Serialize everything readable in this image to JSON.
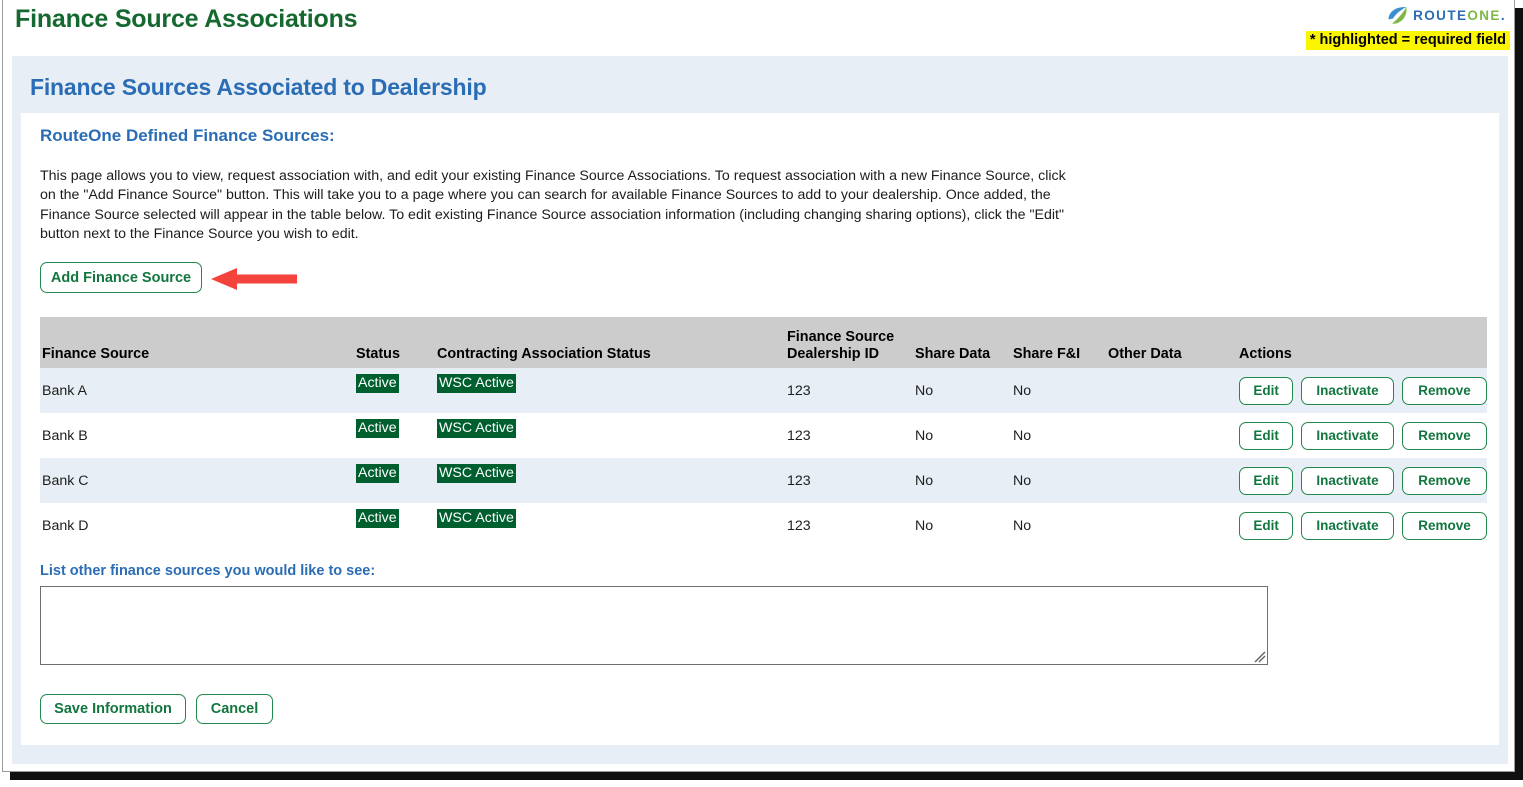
{
  "window": {
    "title": "Finance Source Associations"
  },
  "brand": {
    "logo_icon": "routeone-leaf-icon",
    "name_part1": "ROUTE",
    "name_part2": "ONE",
    "name_suffix": ".",
    "color_blue": "#2a6db5",
    "color_green": "#7cb843"
  },
  "required_note": {
    "text": "* highlighted = required field",
    "background": "#fcf500"
  },
  "panel": {
    "heading": "Finance Sources Associated to Dealership"
  },
  "card": {
    "heading": "RouteOne Defined Finance Sources:",
    "description": "This page allows you to view, request association with, and edit your existing Finance Source Associations. To request association with a new Finance Source, click on the \"Add Finance Source\" button. This will take you to a page where you can search for available Finance Sources to add to your dealership. Once added, the Finance Source selected will appear in the table below. To edit existing Finance Source association information (including changing sharing options), click the \"Edit\" button next to the Finance Source you wish to edit.",
    "add_button_label": "Add Finance Source"
  },
  "annotation": {
    "arrow_icon": "left-arrow-annotation-icon",
    "arrow_color": "#f4433c",
    "points_to": "Add Finance Source"
  },
  "table": {
    "columns": [
      "Finance Source",
      "Status",
      "Contracting Association Status",
      "Finance Source\nDealership ID",
      "Share Data",
      "Share F&I",
      "Other Data",
      "Actions"
    ],
    "column_header_finance_source_dealership_id_line1": "Finance Source",
    "column_header_finance_source_dealership_id_line2": "Dealership ID",
    "header_background": "#cccccc",
    "badge_color": "#005f2e",
    "rows": [
      {
        "finance_source": "Bank A",
        "status": "Active",
        "contracting_association_status": "WSC Active",
        "dealership_id": "123",
        "share_data": "No",
        "share_fi": "No",
        "other_data": "",
        "actions": [
          "Edit",
          "Inactivate",
          "Remove"
        ]
      },
      {
        "finance_source": "Bank B",
        "status": "Active",
        "contracting_association_status": "WSC Active",
        "dealership_id": "123",
        "share_data": "No",
        "share_fi": "No",
        "other_data": "",
        "actions": [
          "Edit",
          "Inactivate",
          "Remove"
        ]
      },
      {
        "finance_source": "Bank C",
        "status": "Active",
        "contracting_association_status": "WSC Active",
        "dealership_id": "123",
        "share_data": "No",
        "share_fi": "No",
        "other_data": "",
        "actions": [
          "Edit",
          "Inactivate",
          "Remove"
        ]
      },
      {
        "finance_source": "Bank D",
        "status": "Active",
        "contracting_association_status": "WSC Active",
        "dealership_id": "123",
        "share_data": "No",
        "share_fi": "No",
        "other_data": "",
        "actions": [
          "Edit",
          "Inactivate",
          "Remove"
        ]
      }
    ]
  },
  "other_sources": {
    "label": "List other finance sources you would like to see:",
    "value": "",
    "placeholder": ""
  },
  "footer": {
    "save_label": "Save Information",
    "cancel_label": "Cancel"
  }
}
